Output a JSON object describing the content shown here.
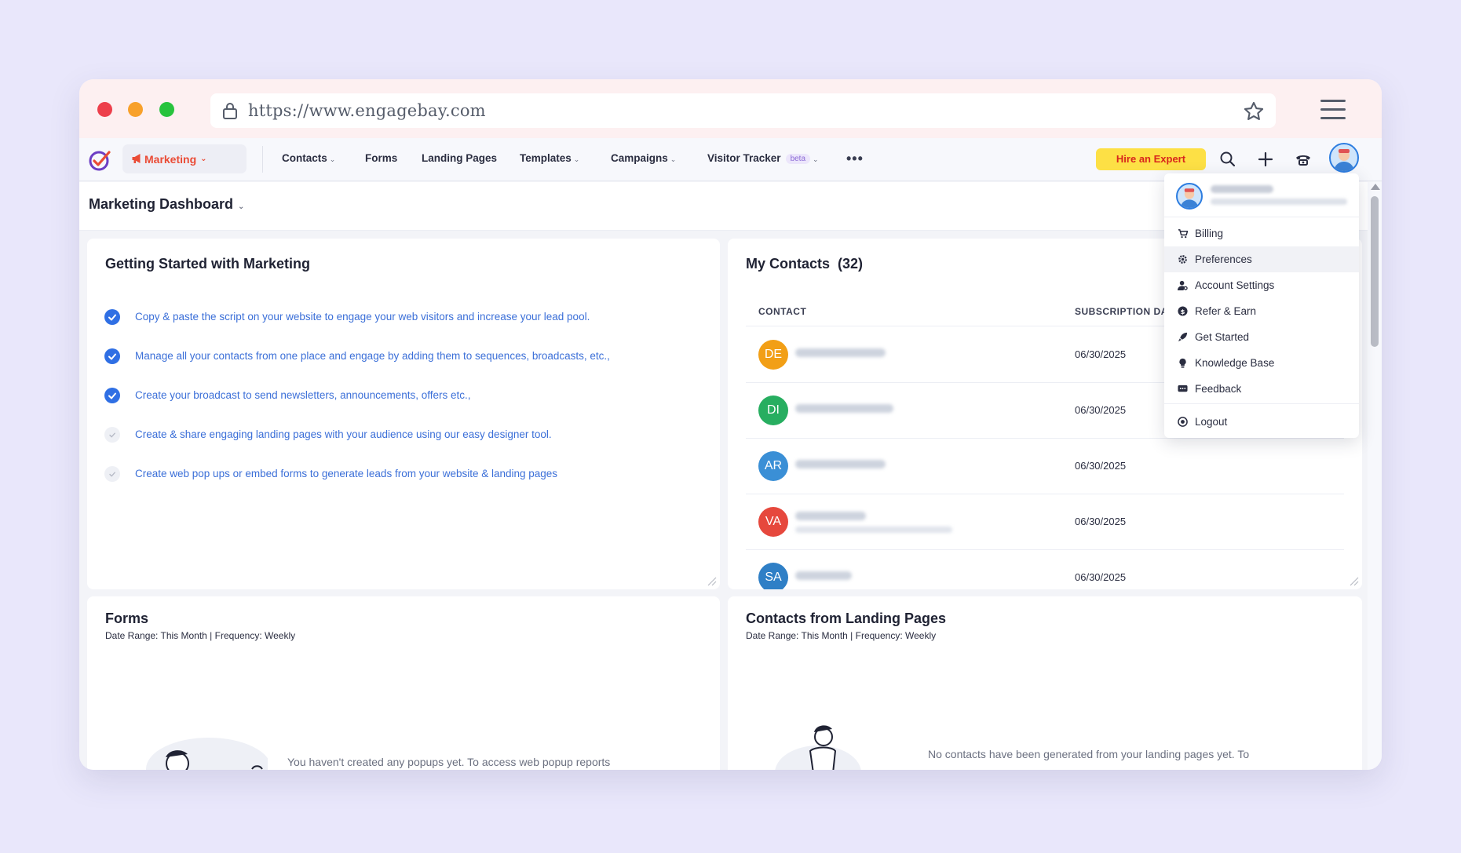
{
  "browser": {
    "url": "https://www.engagebay.com"
  },
  "nav": {
    "module_label": "Marketing",
    "items": [
      {
        "label": "Contacts",
        "has_dropdown": true
      },
      {
        "label": "Forms",
        "has_dropdown": false
      },
      {
        "label": "Landing Pages",
        "has_dropdown": false
      },
      {
        "label": "Templates",
        "has_dropdown": true
      },
      {
        "label": "Campaigns",
        "has_dropdown": true
      },
      {
        "label": "Visitor Tracker",
        "has_dropdown": true,
        "badge": "beta"
      }
    ],
    "hire_expert_label": "Hire an Expert",
    "icons": [
      "search-icon",
      "plus-icon",
      "phone-icon",
      "avatar"
    ],
    "colors": {
      "accent": "#ea4b35",
      "hire_bg": "#fde045",
      "hire_text": "#d8261c",
      "link": "#3b6fd8"
    }
  },
  "dashboard": {
    "title": "Marketing Dashboard"
  },
  "getting_started": {
    "title": "Getting Started with Marketing",
    "items": [
      {
        "text": "Copy & paste the script on your website to engage your web visitors and increase your lead pool.",
        "done": true
      },
      {
        "text": "Manage all your contacts from one place and engage by adding them to sequences, broadcasts, etc.,",
        "done": true
      },
      {
        "text": "Create your broadcast to send newsletters, announcements, offers etc.,",
        "done": true
      },
      {
        "text": "Create & share engaging landing pages with your audience using our easy designer tool.",
        "done": false
      },
      {
        "text": "Create web pop ups or embed forms to generate leads from your website & landing pages",
        "done": false
      }
    ]
  },
  "my_contacts": {
    "title": "My Contacts",
    "count": "(32)",
    "columns": [
      "CONTACT",
      "SUBSCRIPTION DA"
    ],
    "rows": [
      {
        "initials": "DE",
        "color": "#f29f16",
        "date": "06/30/2025"
      },
      {
        "initials": "DI",
        "color": "#27ae60",
        "date": "06/30/2025"
      },
      {
        "initials": "AR",
        "color": "#3a8fd6",
        "date": "06/30/2025"
      },
      {
        "initials": "VA",
        "color": "#e6483d",
        "date": "06/30/2025"
      },
      {
        "initials": "SA",
        "color": "#2f7fc6",
        "date": "06/30/2025"
      }
    ]
  },
  "forms_card": {
    "title": "Forms",
    "subtitle": "Date Range: This Month | Frequency: Weekly",
    "empty_text": "You haven't created any popups yet. To access web popup reports"
  },
  "landing_card": {
    "title": "Contacts from Landing Pages",
    "subtitle": "Date Range: This Month | Frequency: Weekly",
    "empty_text": "No contacts have been generated from your landing pages yet. To"
  },
  "user_menu": {
    "items": [
      {
        "label": "Billing",
        "icon": "cart-icon"
      },
      {
        "label": "Preferences",
        "icon": "gear-icon"
      },
      {
        "label": "Account Settings",
        "icon": "user-settings-icon"
      },
      {
        "label": "Refer & Earn",
        "icon": "dollar-icon"
      },
      {
        "label": "Get Started",
        "icon": "rocket-icon"
      },
      {
        "label": "Knowledge Base",
        "icon": "bulb-icon"
      },
      {
        "label": "Feedback",
        "icon": "chat-icon"
      }
    ],
    "logout_label": "Logout",
    "active_item": "Preferences"
  }
}
